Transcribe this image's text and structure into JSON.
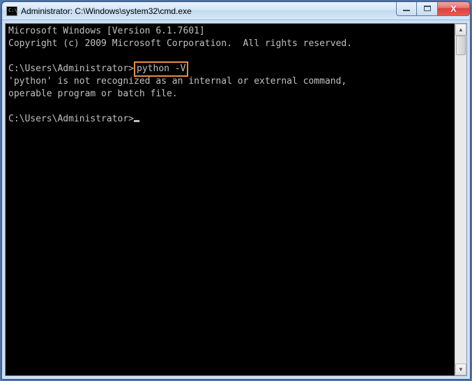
{
  "titlebar": {
    "icon_text": "C:\\",
    "title": "Administrator: C:\\Windows\\system32\\cmd.exe"
  },
  "window_controls": {
    "close_glyph": "X"
  },
  "terminal": {
    "line1": "Microsoft Windows [Version 6.1.7601]",
    "line2": "Copyright (c) 2009 Microsoft Corporation.  All rights reserved.",
    "prompt1_path": "C:\\Users\\Administrator>",
    "prompt1_cmd": "python -V",
    "err1": "'python' is not recognized as an internal or external command,",
    "err2": "operable program or batch file.",
    "prompt2_path": "C:\\Users\\Administrator>"
  },
  "scrollbar": {
    "up": "▲",
    "down": "▼"
  }
}
